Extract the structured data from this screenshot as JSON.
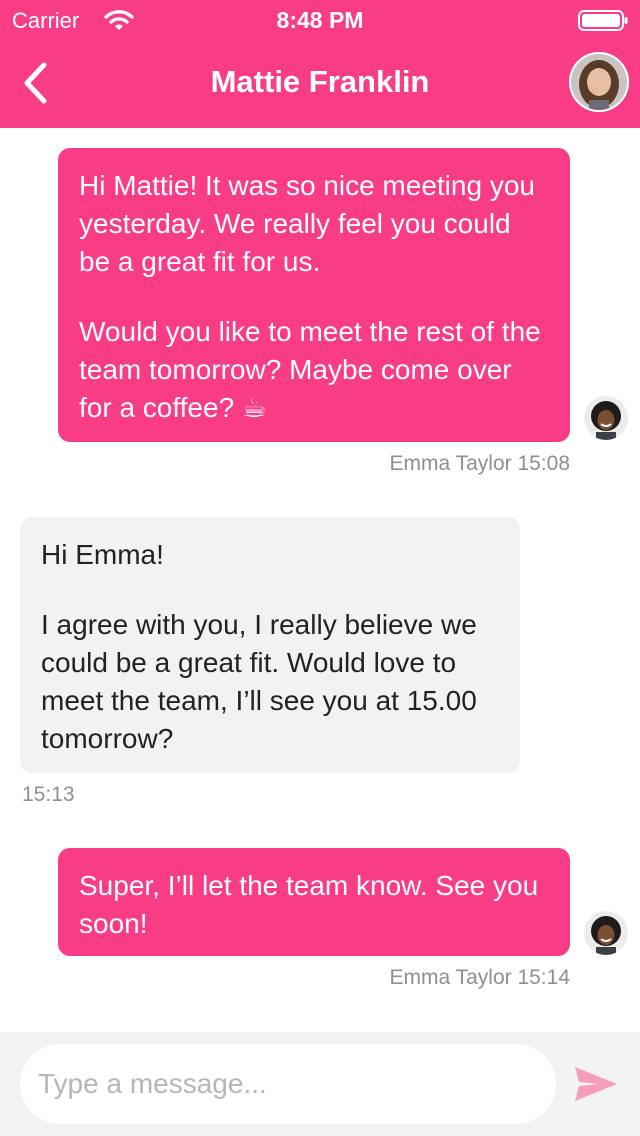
{
  "status_bar": {
    "carrier": "Carrier",
    "time": "8:48 PM",
    "wifi_icon": "wifi-icon",
    "battery_icon": "battery-icon"
  },
  "header": {
    "back_icon": "chevron-left-icon",
    "title": "Mattie Franklin",
    "avatar": "contact-avatar"
  },
  "messages": [
    {
      "direction": "outgoing",
      "paragraphs": [
        "Hi Mattie! It was so nice meeting you yesterday. We really feel you could be a great fit for us.",
        "Would you like to meet the rest of the team tomorrow? Maybe come over for a coffee? ☕"
      ],
      "meta": "Emma Taylor 15:08",
      "avatar": "sender-avatar"
    },
    {
      "direction": "incoming",
      "paragraphs": [
        "Hi Emma!",
        "I agree with you, I really believe we could be a great fit. Would love to meet the team, I’ll see you at 15.00 tomorrow?"
      ],
      "meta": "15:13"
    },
    {
      "direction": "outgoing",
      "paragraphs": [
        "Super, I’ll let the team know. See you soon!"
      ],
      "meta": "Emma Taylor 15:14",
      "avatar": "sender-avatar"
    }
  ],
  "composer": {
    "placeholder": "Type a message...",
    "value": "",
    "send_icon": "send-icon"
  },
  "colors": {
    "accent": "#f83c86",
    "incoming_bubble": "#f2f2f4",
    "composer_bg": "#f3f3f5",
    "meta_text": "#8e8e93"
  }
}
